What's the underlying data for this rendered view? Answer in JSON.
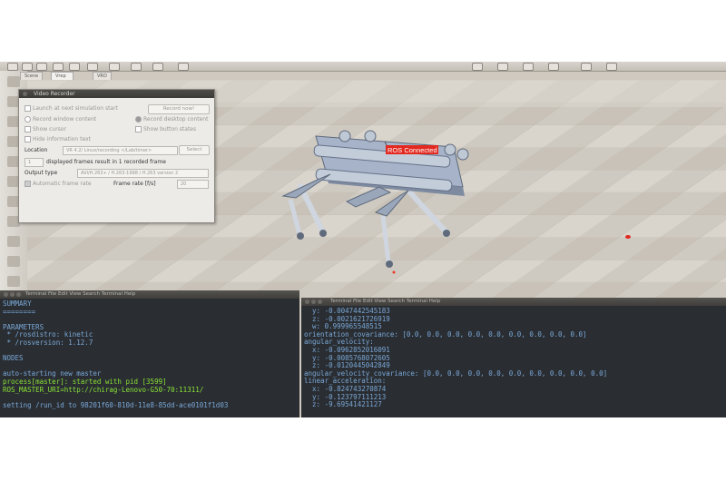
{
  "toolbar": {
    "tabs": [
      "Scene",
      "Vrep scene",
      "VRO ..."
    ]
  },
  "robot": {
    "ros_label": "ROS Connected"
  },
  "colors": {
    "floor": "#d0cbc2",
    "ros_label_bg": "#e2281f",
    "terminal_bg": "#2a2e33",
    "robot_body": "#a6b3c8"
  },
  "video_recorder": {
    "title": "Video Recorder",
    "launch_label": "Launch at next simulation start",
    "record_now": "Record now!",
    "record_window": "Record window content",
    "record_desktop": "Record desktop content",
    "show_cursor": "Show cursor",
    "show_button_states": "Show button states",
    "hide_info": "Hide information text",
    "location_label": "Location",
    "location_value": "VR 4.2/ Linux/recording </Lab/timer>",
    "select_button": "Select",
    "frames_value": "1",
    "frames_text": "displayed frames result in 1 recorded frame",
    "output_type_label": "Output type",
    "output_type_value": "AVI/H.263+ / H.263-1998 / H.263 version 2",
    "auto_frame_rate": "Automatic frame rate",
    "frame_rate_label": "Frame rate [f/s]",
    "frame_rate_value": "20"
  },
  "terminal_left": {
    "menu": "Terminal  File  Edit  View  Search  Terminal  Help",
    "lines": [
      {
        "t": "SUMMARY",
        "c": ""
      },
      {
        "t": "========",
        "c": ""
      },
      {
        "t": "",
        "c": ""
      },
      {
        "t": "PARAMETERS",
        "c": ""
      },
      {
        "t": " * /rosdistro: kinetic",
        "c": ""
      },
      {
        "t": " * /rosversion: 1.12.7",
        "c": ""
      },
      {
        "t": "",
        "c": ""
      },
      {
        "t": "NODES",
        "c": ""
      },
      {
        "t": "",
        "c": ""
      },
      {
        "t": "auto-starting new master",
        "c": ""
      },
      {
        "t": "process[master]: started with pid [3599]",
        "c": "g"
      },
      {
        "t": "ROS_MASTER_URI=http://chirag-Lenovo-G50-70:11311/",
        "c": "g"
      },
      {
        "t": "",
        "c": ""
      },
      {
        "t": "setting /run_id to 98201f60-810d-11e8-85dd-ace0101f1d03",
        "c": ""
      }
    ]
  },
  "terminal_right": {
    "menu": "Terminal  File  Edit  View  Search  Terminal  Help",
    "lines": [
      {
        "t": "  y: -0.0047442545183",
        "c": ""
      },
      {
        "t": "  z: -0.0021621726919",
        "c": ""
      },
      {
        "t": "  w: 0.999965548515",
        "c": ""
      },
      {
        "t": "orientation_covariance: [0.0, 0.0, 0.0, 0.0, 0.0, 0.0, 0.0, 0.0, 0.0]",
        "c": ""
      },
      {
        "t": "angular_velocity:",
        "c": ""
      },
      {
        "t": "  x: -0.0962852016091",
        "c": ""
      },
      {
        "t": "  y: -0.0085768072605",
        "c": ""
      },
      {
        "t": "  z: -0.0120445042849",
        "c": ""
      },
      {
        "t": "angular_velocity_covariance: [0.0, 0.0, 0.0, 0.0, 0.0, 0.0, 0.0, 0.0, 0.0]",
        "c": ""
      },
      {
        "t": "linear_acceleration:",
        "c": ""
      },
      {
        "t": "  x: -0.824743270874",
        "c": ""
      },
      {
        "t": "  y: -0.123797111213",
        "c": ""
      },
      {
        "t": "  z: -9.69541421127",
        "c": ""
      }
    ]
  }
}
